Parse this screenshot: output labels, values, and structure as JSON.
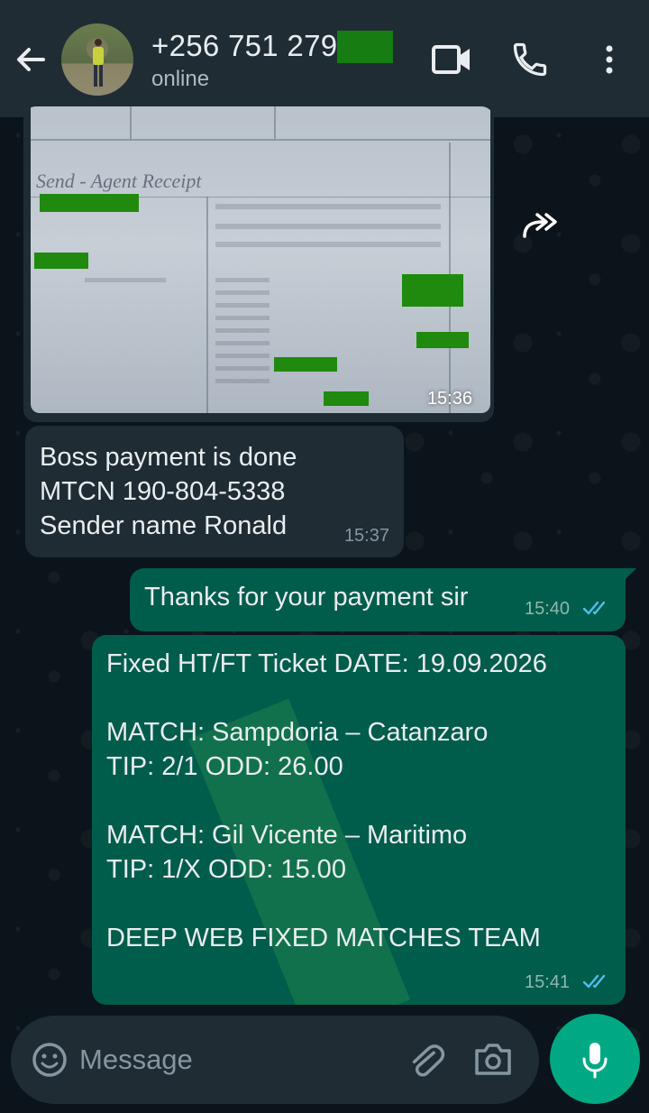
{
  "header": {
    "contact_name": "+256 751 279",
    "status": "online"
  },
  "messages": {
    "image": {
      "receipt_title": "Send - Agent Receipt",
      "time": "15:36"
    },
    "incoming": {
      "lines": [
        "Boss payment is done",
        "MTCN 190-804-5338",
        "Sender name Ronald"
      ],
      "time": "15:37"
    },
    "outgoing_1": {
      "text": "Thanks for your payment sir",
      "time": "15:40"
    },
    "outgoing_2": {
      "lines": [
        "Fixed HT/FT Ticket DATE: 19.09.2026",
        "",
        "MATCH: Sampdoria – Catanzaro",
        "TIP: 2/1  ODD: 26.00",
        "",
        "MATCH: Gil Vicente – Maritimo",
        "TIP: 1/X  ODD: 15.00",
        "",
        "DEEP WEB FIXED MATCHES TEAM"
      ],
      "time": "15:41"
    }
  },
  "composer": {
    "placeholder": "Message"
  },
  "colors": {
    "header_bg": "#1f2c34",
    "chat_bg": "#0b141a",
    "incoming_bubble": "#1f2c34",
    "outgoing_bubble": "#005c4b",
    "accent": "#00a884",
    "read_tick": "#53bdeb"
  },
  "icons": {
    "back": "arrow-left-icon",
    "video": "video-camera-icon",
    "call": "phone-icon",
    "menu": "more-vertical-icon",
    "forward": "forward-icon",
    "emoji": "emoji-icon",
    "attach": "paperclip-icon",
    "camera": "camera-icon",
    "mic": "microphone-icon",
    "read": "double-check-icon"
  }
}
